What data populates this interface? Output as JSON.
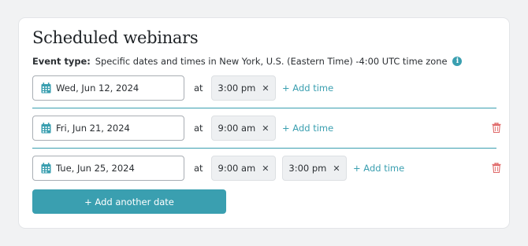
{
  "page": {
    "title": "Scheduled webinars",
    "event_type_label": "Event type:",
    "event_type_value": "Specific dates and times in New York, U.S. (Eastern Time) -4:00 UTC time zone",
    "info_icon_glyph": "i"
  },
  "rows": [
    {
      "date": "Wed, Jun 12, 2024",
      "at": "at",
      "times": [
        "3:00 pm"
      ],
      "add_time": "+ Add time",
      "deletable": false
    },
    {
      "date": "Fri, Jun 21, 2024",
      "at": "at",
      "times": [
        "9:00 am"
      ],
      "add_time": "+ Add time",
      "deletable": true
    },
    {
      "date": "Tue, Jun 25, 2024",
      "at": "at",
      "times": [
        "9:00 am",
        "3:00 pm"
      ],
      "add_time": "+ Add time",
      "deletable": true
    }
  ],
  "remove_glyph": "✕",
  "add_date_button": "+ Add another date",
  "colors": {
    "accent": "#3a9fb0",
    "delete": "#e06a6a"
  },
  "icons": {
    "calendar": "calendar-icon",
    "remove_time": "close-icon",
    "delete_row": "trash-icon",
    "info": "info-icon"
  }
}
